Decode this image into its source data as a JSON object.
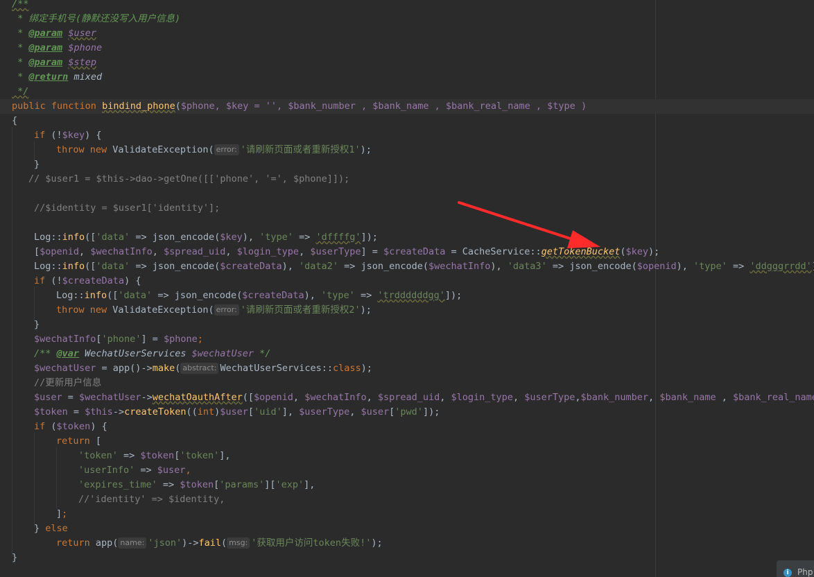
{
  "editor": {
    "doc_comment": {
      "open": "/**",
      "desc": " * 绑定手机号(静默还没写入用户信息)",
      "params": [
        {
          "tag": "@param",
          "name": "$user"
        },
        {
          "tag": "@param",
          "name": "$phone"
        },
        {
          "tag": "@param",
          "name": "$step"
        }
      ],
      "return_tag": "@return",
      "return_type": "mixed",
      "close": " */"
    },
    "signature": {
      "modifiers": "public function",
      "name": "bindind_phone",
      "args": "$phone, $key = '', $bank_number , $bank_name , $bank_real_name , $type )"
    },
    "hints": {
      "error": "error:",
      "abstract": "abstract:",
      "name": "name:",
      "msg": "msg:"
    },
    "strings": {
      "err1": "'请刷新页面或者重新授权1'",
      "err2": "'请刷新页面或者重新授权2'",
      "fail": "'获取用户访问token失败!'",
      "json": "'json'"
    },
    "comments": {
      "getone": "// $user1 = $this->dao->getOne([['phone', '=', $phone]]);",
      "identity": "//$identity = $user1['identity'];",
      "update": "//更新用户信息",
      "identity_ret": "//'identity' => $identity,",
      "var_doc": "/** @var WechatUserServices $wechatUser */"
    },
    "method_highlight": "getTokenBucket"
  },
  "status": {
    "toast_label": "Php"
  }
}
